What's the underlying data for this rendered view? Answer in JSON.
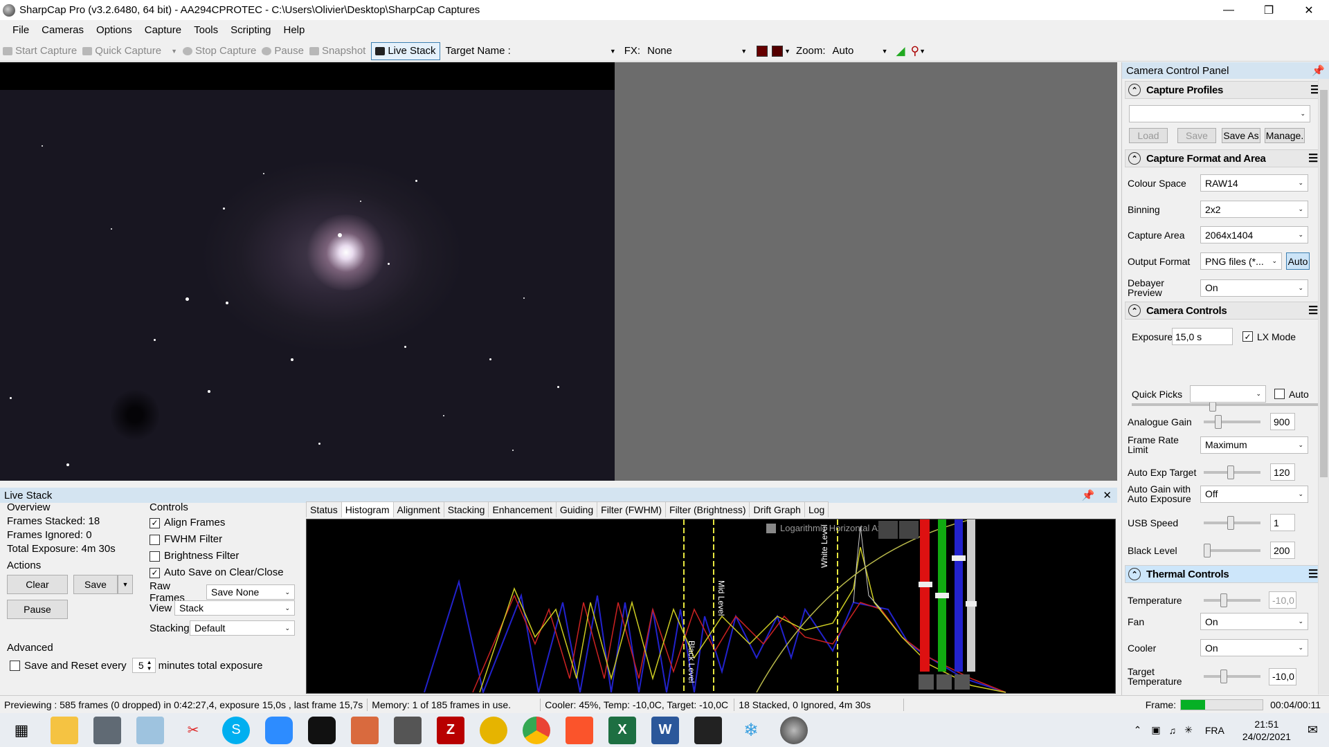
{
  "window": {
    "title": "SharpCap Pro (v3.2.6480, 64 bit) - AA294CPROTEC - C:\\Users\\Olivier\\Desktop\\SharpCap Captures"
  },
  "menu": [
    "File",
    "Cameras",
    "Options",
    "Capture",
    "Tools",
    "Scripting",
    "Help"
  ],
  "toolbar": {
    "start_capture": "Start Capture",
    "quick_capture": "Quick Capture",
    "stop_capture": "Stop Capture",
    "pause": "Pause",
    "snapshot": "Snapshot",
    "live_stack": "Live Stack",
    "target_name_label": "Target Name :",
    "target_name_value": "",
    "fx_label": "FX:",
    "fx_value": "None",
    "zoom_label": "Zoom:",
    "zoom_value": "Auto"
  },
  "ccp": {
    "title": "Camera Control Panel",
    "capture_profiles": {
      "title": "Capture Profiles",
      "load": "Load",
      "save": "Save",
      "save_as": "Save As",
      "manage": "Manage."
    },
    "format": {
      "title": "Capture Format and Area",
      "colour_space_label": "Colour Space",
      "colour_space": "RAW14",
      "binning_label": "Binning",
      "binning": "2x2",
      "capture_area_label": "Capture Area",
      "capture_area": "2064x1404",
      "output_format_label": "Output Format",
      "output_format": "PNG files (*...",
      "auto": "Auto",
      "debayer_label": "Debayer Preview",
      "debayer": "On"
    },
    "controls": {
      "title": "Camera Controls",
      "exposure_label": "Exposure",
      "exposure": "15,0 s",
      "lx_mode": "LX Mode",
      "quick_picks_label": "Quick Picks",
      "auto": "Auto",
      "analogue_gain_label": "Analogue Gain",
      "analogue_gain": "900",
      "frame_rate_label": "Frame Rate Limit",
      "frame_rate": "Maximum",
      "auto_exp_label": "Auto Exp Target",
      "auto_exp": "120",
      "auto_gain_label": "Auto Gain with Auto Exposure",
      "auto_gain": "Off",
      "usb_label": "USB Speed",
      "usb": "1",
      "black_label": "Black Level",
      "black": "200"
    },
    "thermal": {
      "title": "Thermal Controls",
      "temp_label": "Temperature",
      "temp": "-10,0",
      "fan_label": "Fan",
      "fan": "On",
      "cooler_label": "Cooler",
      "cooler": "On",
      "target_label": "Target Temperature",
      "target": "-10,0"
    }
  },
  "livestack": {
    "title": "Live Stack",
    "overview": "Overview",
    "frames_stacked": "Frames Stacked: 18",
    "frames_ignored": "Frames Ignored:  0",
    "total_exposure": "Total Exposure:  4m 30s",
    "actions": "Actions",
    "clear": "Clear",
    "save": "Save",
    "pause": "Pause",
    "advanced": "Advanced",
    "save_reset": "Save and Reset every",
    "minutes_value": "5",
    "minutes_label": "minutes total exposure",
    "controls": "Controls",
    "align_frames": "Align Frames",
    "fwhm_filter": "FWHM Filter",
    "brightness_filter": "Brightness Filter",
    "auto_save": "Auto Save on Clear/Close",
    "raw_frames_label": "Raw Frames",
    "raw_frames": "Save None",
    "view_label": "View",
    "view": "Stack",
    "stacking_label": "Stacking",
    "stacking": "Default",
    "tabs": [
      "Status",
      "Histogram",
      "Alignment",
      "Stacking",
      "Enhancement",
      "Guiding",
      "Filter (FWHM)",
      "Filter (Brightness)",
      "Drift Graph",
      "Log"
    ],
    "histo": {
      "log_axis": "Logarithmic Horizontal Axis",
      "black_level": "Black Level",
      "mid_level": "Mid Level",
      "white_level": "White Level"
    }
  },
  "status": {
    "preview": "Previewing : 585 frames (0 dropped) in 0:42:27,4, exposure 15,0s , last frame 15,7s",
    "memory": "Memory: 1 of 185 frames in use.",
    "cooler": "Cooler: 45%, Temp: -10,0C, Target: -10,0C",
    "stacked": "18 Stacked, 0 Ignored, 4m 30s",
    "frame_label": "Frame:",
    "frame_time": "00:04/00:11",
    "frame_progress": 0.3
  },
  "taskbar": {
    "lang": "FRA",
    "time": "21:51",
    "date": "24/02/2021"
  }
}
